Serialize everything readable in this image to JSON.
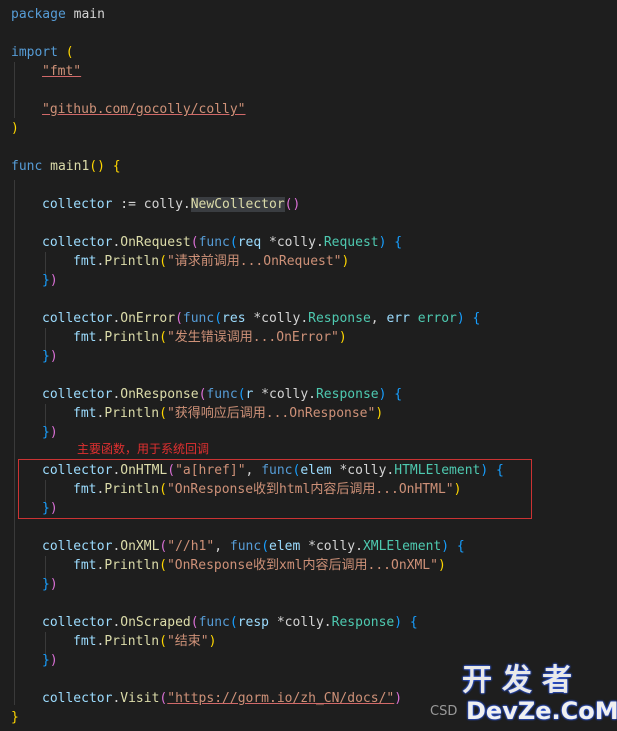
{
  "code": {
    "l1_package": "package",
    "l1_main": "main",
    "l3_import": "import",
    "l3_paren": "(",
    "l4_fmt": "\"fmt\"",
    "l6_colly": "\"github.com/gocolly/colly\"",
    "l7_paren": ")",
    "l9_func": "func",
    "l9_name": "main1",
    "l9_rest": "() {",
    "l11_collector": "collector",
    "l11_assign": " := ",
    "l11_colly": "colly.",
    "l11_newcollector": "NewCollector",
    "l11_parens": "()",
    "on_request": {
      "method": "OnRequest",
      "param": "req",
      "ptype": "Request",
      "println": "Println",
      "message": "\"请求前调用...OnRequest\""
    },
    "on_error": {
      "method": "OnError",
      "param": "res",
      "ptype": "Response",
      "param2": "err",
      "ptype2": "error",
      "println": "Println",
      "message": "\"发生错误调用...OnError\""
    },
    "on_response": {
      "method": "OnResponse",
      "param": "r",
      "ptype": "Response",
      "println": "Println",
      "message": "\"获得响应后调用...OnResponse\""
    },
    "on_html": {
      "method": "OnHTML",
      "selector": "\"a[href]\"",
      "param": "elem",
      "ptype": "HTMLElement",
      "println": "Println",
      "message": "\"OnResponse收到html内容后调用...OnHTML\""
    },
    "on_xml": {
      "method": "OnXML",
      "selector": "\"//h1\"",
      "param": "elem",
      "ptype": "XMLElement",
      "println": "Println",
      "message": "\"OnResponse收到xml内容后调用...OnXML\""
    },
    "on_scraped": {
      "method": "OnScraped",
      "param": "resp",
      "ptype": "Response",
      "println": "Println",
      "message": "\"结束\""
    },
    "visit": {
      "method": "Visit",
      "url": "\"https://gorm.io/zh_CN/docs/\""
    },
    "closing_brace": "}"
  },
  "annotation": {
    "text": "主要函数，用于系统回调",
    "color": "#e03030"
  },
  "watermark": {
    "brand": "开发者",
    "domain": "DevZe.CoM",
    "csdn": "CSD"
  },
  "colors": {
    "background": "#1e1e1e",
    "keyword": "#569cd6",
    "identifier": "#9cdcfe",
    "function": "#dcdcaa",
    "type": "#4ec9b0",
    "string": "#ce9178",
    "bracket_1": "#ffd700",
    "bracket_2": "#da70d6",
    "bracket_3": "#179fff"
  }
}
